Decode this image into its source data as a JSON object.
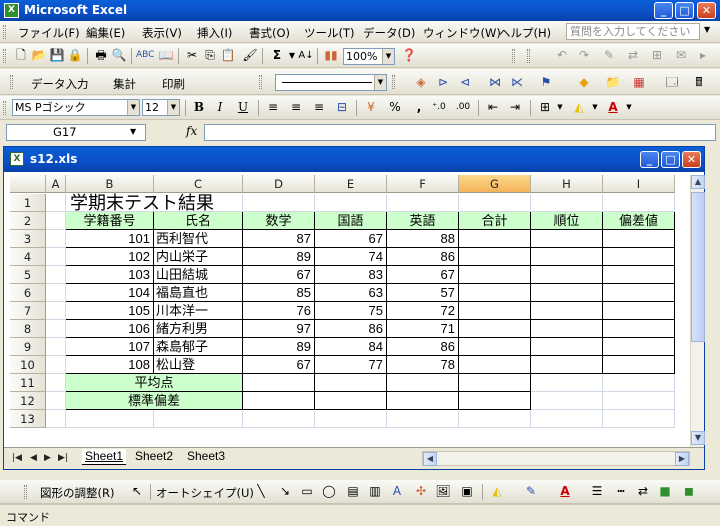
{
  "app": {
    "title": "Microsoft Excel",
    "icon_label": "X"
  },
  "window_buttons": {
    "minimize": "_",
    "restore": "□",
    "close": "✕"
  },
  "menu": {
    "items": [
      "ファイル(F)",
      "編集(E)",
      "表示(V)",
      "挿入(I)",
      "書式(O)",
      "ツール(T)",
      "データ(D)",
      "ウィンドウ(W)",
      "ヘルプ(H)"
    ],
    "ask_placeholder": "質問を入力してください"
  },
  "standard_toolbar": {
    "zoom": "100%",
    "sigma": "Σ"
  },
  "custom_toolbar": {
    "items": [
      "データ入力",
      "集計",
      "印刷"
    ]
  },
  "formatting_toolbar": {
    "font": "MS Pゴシック",
    "size": "12",
    "bold": "B",
    "italic": "I",
    "underline": "U",
    "percent": "%",
    "comma": ","
  },
  "formula_bar": {
    "cell_ref": "G17",
    "fx": "fx",
    "content": ""
  },
  "workbook": {
    "title": "s12.xls",
    "columns": [
      "A",
      "B",
      "C",
      "D",
      "E",
      "F",
      "G",
      "H",
      "I"
    ],
    "selected_column": "G",
    "row_numbers": [
      "1",
      "2",
      "3",
      "4",
      "5",
      "6",
      "7",
      "8",
      "9",
      "10",
      "11",
      "12",
      "13"
    ],
    "sheet_title": "学期末テスト結果",
    "headers": [
      "学籍番号",
      "氏名",
      "数学",
      "国語",
      "英語",
      "合計",
      "順位",
      "偏差値"
    ],
    "students": [
      {
        "id": "101",
        "name": "西利智代",
        "math": "87",
        "jpn": "67",
        "eng": "88"
      },
      {
        "id": "102",
        "name": "内山栄子",
        "math": "89",
        "jpn": "74",
        "eng": "86"
      },
      {
        "id": "103",
        "name": "山田結城",
        "math": "67",
        "jpn": "83",
        "eng": "67"
      },
      {
        "id": "104",
        "name": "福島直也",
        "math": "85",
        "jpn": "63",
        "eng": "57"
      },
      {
        "id": "105",
        "name": "川本洋一",
        "math": "76",
        "jpn": "75",
        "eng": "72"
      },
      {
        "id": "106",
        "name": "緒方利男",
        "math": "97",
        "jpn": "86",
        "eng": "71"
      },
      {
        "id": "107",
        "name": "森島郁子",
        "math": "89",
        "jpn": "84",
        "eng": "86"
      },
      {
        "id": "108",
        "name": "松山登",
        "math": "67",
        "jpn": "77",
        "eng": "78"
      }
    ],
    "summary_rows": [
      "平均点",
      "標準偏差"
    ],
    "sheet_tabs": [
      "Sheet1",
      "Sheet2",
      "Sheet3"
    ],
    "active_sheet": "Sheet1"
  },
  "drawing_toolbar": {
    "adjust": "図形の調整(R)",
    "autoshape": "オートシェイプ(U)"
  },
  "status": {
    "text": "コマンド"
  },
  "colors": {
    "title_blue": "#0B4FC6",
    "header_green": "#CCFFCC",
    "selected_col": "#F5B35A"
  }
}
